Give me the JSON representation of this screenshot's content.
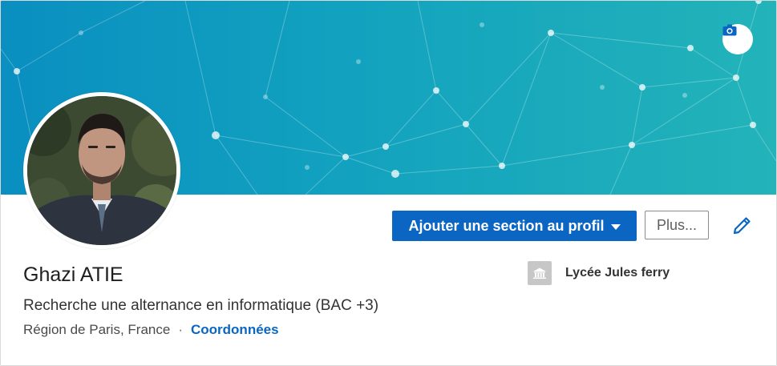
{
  "banner": {
    "background_color_start": "#0a8fc0",
    "background_color_end": "#23b3b9",
    "camera_icon": "camera-icon"
  },
  "profile": {
    "name": "Ghazi ATIE",
    "headline": "Recherche une alternance en informatique (BAC +3)",
    "location": "Région de Paris, France",
    "separator": "·",
    "contact_link": "Coordonnées",
    "school": {
      "name": "Lycée Jules ferry",
      "logo_icon": "school-building-icon"
    }
  },
  "actions": {
    "add_section_label": "Ajouter une section au profil",
    "more_label": "Plus...",
    "edit_icon": "pencil-icon"
  },
  "colors": {
    "primary": "#0a66c2",
    "link": "#0a66c2"
  }
}
